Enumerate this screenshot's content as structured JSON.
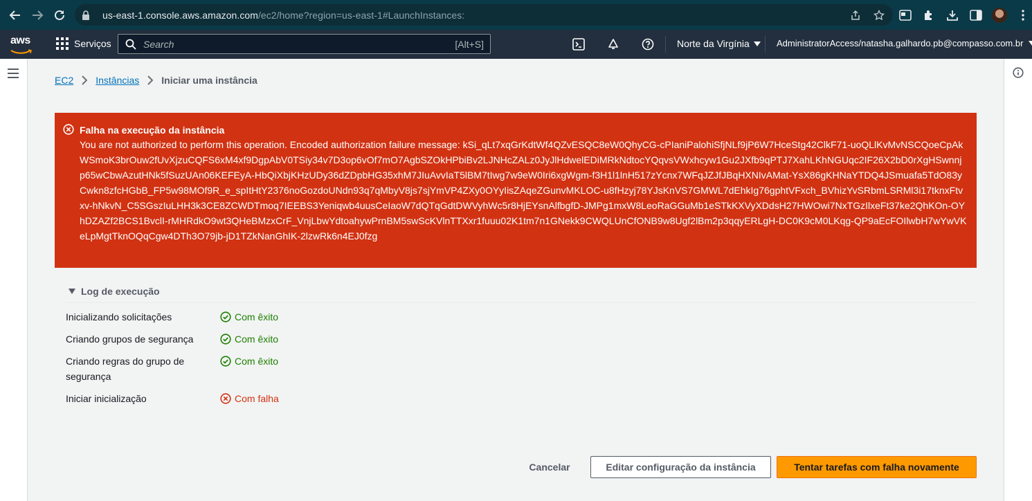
{
  "browser": {
    "url_host": "us-east-1.console.aws.amazon.com",
    "url_path": "/ec2/home?region=us-east-1#LaunchInstances:"
  },
  "aws_nav": {
    "logo_text": "aws",
    "services_label": "Serviços",
    "search_placeholder": "Search",
    "search_shortcut": "[Alt+S]",
    "region_label": "Norte da Virgínia",
    "account_label": "AdministratorAccess/natasha.galhardo.pb@compasso.com.br"
  },
  "breadcrumb": {
    "root": "EC2",
    "instances": "Instâncias",
    "current": "Iniciar uma instância"
  },
  "flash": {
    "title": "Falha na execução da instância",
    "message": "You are not authorized to perform this operation. Encoded authorization failure message: kSi_qLt7xqGrKdtWf4QZvESQC8eW0QhyCG-cPIaniPalohiSfjNLf9jP6W7HceStg42ClkF71-uoQLlKvMvNSCQoeCpAkWSmoK3brOuw2fUvXjzuCQFS6xM4xf9DgpAbV0TSiy34v7D3op6vOf7mO7AgbSZOkHPbiBv2LJNHcZALz0JyJlHdwelEDiMRkNdtocYQqvsVWxhcyw1Gu2JXfb9qPTJ7XahLKhNGUqc2IF26X2bD0rXgHSwnnjp65wCbwAzutHNk5fSuzUAn06KEFEyA-HbQiXbjKHzUDy36dZDpbHG35xhM7JIuAvvIaT5lBM7tIwg7w9eW0Iri6xgWgm-f3H1l1lnH517zYcnx7WFqJZJfJBqHXNIvAMat-YsX86gKHNaYTDQ4JSmuafa5TdO83yCwkn8zfcHGbB_FP5w98MOf9R_e_spItHtY2376noGozdoUNdn93q7qMbyV8js7sjYmVP4ZXy0OYyIisZAqeZGunvMKLOC-u8fHzyj78YJsKnVS7GMWL7dEhkIg76gphtVFxch_BVhizYvSRbmLSRMl3i17tknxFtvxv-hNkvN_C5SGszIuLHH3k3CE8ZCWDTmoq7IEEBS3Yeniqwb4uusCeIaoW7dQTqGdtDWVyhWc5r8HjEYsnAlfbgfD-JMPg1mxW8LeoRaGGuMb1eSTkKXVyXDdsH27HWOwi7NxTGzIlxeFt37ke2QhKOn-OYhDZAZf2BCS1BvclI-rMHRdkO9wt3QHeBMzxCrF_VnjLbwYdtoahywPrnBM5swScKVlnTTXxr1fuuu02K1tm7n1GNekk9CWQLUnCfONB9w8Ugf2lBm2p3qqyERLgH-DC0K9cM0LKqg-QP9aEcFOIlwbH7wYwVKeLpMgtTknOQqCgw4DTh3O79jb-jD1TZkNanGhIK-2lzwRk6n4EJ0fzg"
  },
  "log": {
    "header": "Log de execução",
    "rows": [
      {
        "label": "Inicializando solicitações",
        "status": "Com êxito"
      },
      {
        "label": "Criando grupos de segurança",
        "status": "Com êxito"
      },
      {
        "label": "Criando regras do grupo de segurança",
        "status": "Com êxito"
      },
      {
        "label": "Iniciar inicialização",
        "status": "Com falha"
      }
    ]
  },
  "buttons": {
    "cancel": "Cancelar",
    "edit": "Editar configuração da instância",
    "retry": "Tentar tarefas com falha novamente"
  },
  "colors": {
    "browser_bar": "#0a3a47",
    "aws_nav": "#232f3e",
    "error": "#d13212",
    "success": "#1d8102",
    "primary_button": "#ff9900",
    "link": "#0073bb"
  }
}
